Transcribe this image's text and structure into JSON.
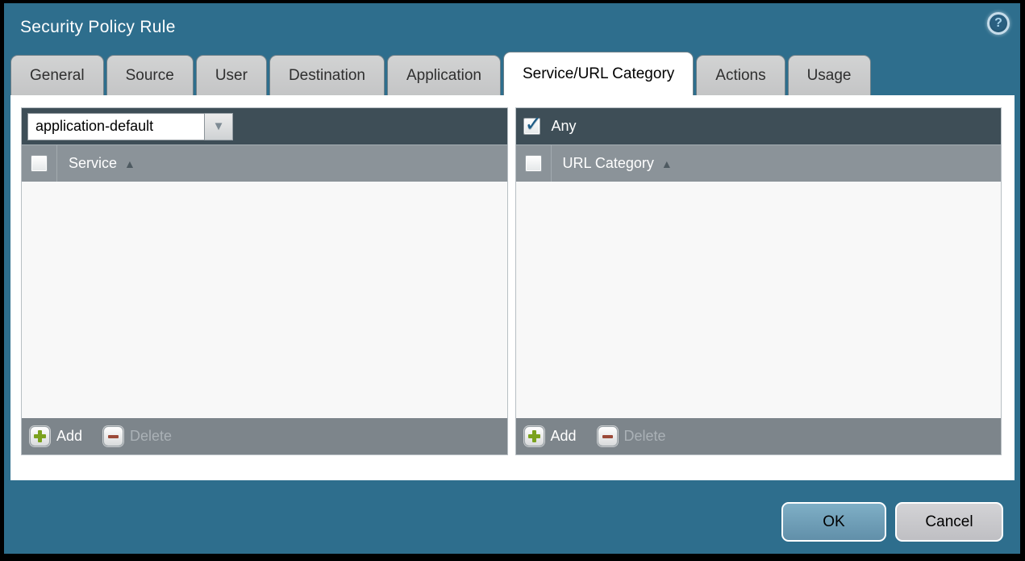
{
  "window": {
    "title": "Security Policy Rule"
  },
  "help": {
    "icon": "?"
  },
  "tabs": [
    {
      "label": "General",
      "active": false
    },
    {
      "label": "Source",
      "active": false
    },
    {
      "label": "User",
      "active": false
    },
    {
      "label": "Destination",
      "active": false
    },
    {
      "label": "Application",
      "active": false
    },
    {
      "label": "Service/URL Category",
      "active": true
    },
    {
      "label": "Actions",
      "active": false
    },
    {
      "label": "Usage",
      "active": false
    }
  ],
  "service_panel": {
    "dropdown": {
      "value": "application-default",
      "expander_icon": "▼"
    },
    "header": {
      "checkbox_checked": false,
      "column_label": "Service",
      "sort_icon": "▲"
    },
    "rows": [],
    "footer": {
      "add_label": "Add",
      "delete_label": "Delete",
      "delete_enabled": false
    }
  },
  "url_category_panel": {
    "any": {
      "checkbox_checked": true,
      "check_icon": "✓",
      "label": "Any"
    },
    "header": {
      "checkbox_checked": false,
      "column_label": "URL Category",
      "sort_icon": "▲"
    },
    "rows": [],
    "footer": {
      "add_label": "Add",
      "delete_label": "Delete",
      "delete_enabled": false
    }
  },
  "dialog_actions": {
    "ok_label": "OK",
    "cancel_label": "Cancel"
  },
  "colors": {
    "dialog_teal": "#2e6e8d",
    "outer_border": "#000000",
    "panel_dark_bar": "#3e4e57",
    "column_header_gray": "#8b9399",
    "footer_bar_gray": "#7d858b",
    "table_body_light": "#f8f8f8",
    "tab_gray": "#c9caca",
    "active_tab_white": "#ffffff",
    "ok_button_blue": "#6ba2bc",
    "cancel_button_gray": "#c9c9cd",
    "add_plus_green": "#7ba21e",
    "delete_minus_red": "#9b4a39",
    "check_blue": "#1e5d87"
  }
}
